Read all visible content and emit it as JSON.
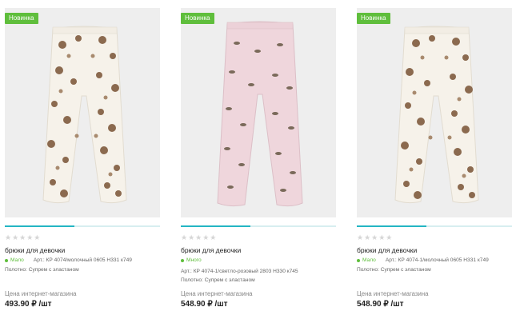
{
  "products": [
    {
      "badge": "Новинка",
      "rating_stars": "★★★★★",
      "title": "брюки для девочки",
      "stock_label": "Мало",
      "article": "Арт.: КР 4074/молочный 0605 Н331 к749",
      "fabric": "Полотно: Супрем с эластаном",
      "price_label": "Цена интернет-магазина",
      "price": "493.90 ₽ /шт",
      "image_alt": "cream leggings with teddy bear print",
      "progress": 0.45,
      "colors": {
        "fabric": "#f6f2ea",
        "print": "#8b6a4f"
      }
    },
    {
      "badge": "Новинка",
      "rating_stars": "★★★★★",
      "title": "брюки для девочки",
      "stock_label": "Много",
      "article": "Арт.: КР 4074-1/светло-розовый 2803 Н330 к745",
      "fabric": "Полотно: Супрем с эластаном",
      "price_label": "Цена интернет-магазина",
      "price": "548.90 ₽ /шт",
      "image_alt": "light pink leggings with bird print",
      "progress": 0.45,
      "colors": {
        "fabric": "#efd6dc",
        "print": "#7a6a5a"
      }
    },
    {
      "badge": "Новинка",
      "rating_stars": "★★★★★",
      "title": "брюки для девочки",
      "stock_label": "Мало",
      "article": "Арт.: КР 4074-1/молочный 0605 Н331 к749",
      "fabric": "Полотно: Супрем с эластаном",
      "price_label": "Цена интернет-магазина",
      "price": "548.90 ₽ /шт",
      "image_alt": "cream leggings with teddy bear print",
      "progress": 0.45,
      "colors": {
        "fabric": "#f6f2ea",
        "print": "#8b6a4f"
      }
    }
  ],
  "colors": {
    "badge": "#5fbe3c",
    "accent": "#24b6c4",
    "stock": "#5fbe3c"
  }
}
